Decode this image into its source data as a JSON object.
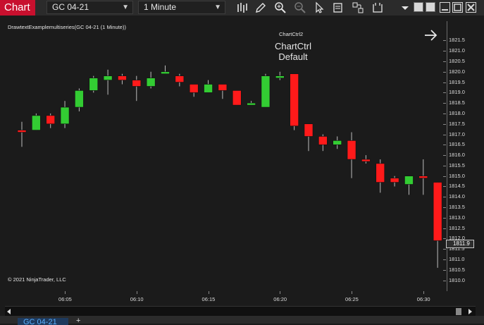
{
  "toolbar": {
    "chart_tab_label": "Chart",
    "instrument": "GC 04-21",
    "interval": "1 Minute"
  },
  "chart": {
    "title": "DrawtextExamplemultiseries(GC 04-21 (1 Minute))",
    "copyright": "© 2021 NinjaTrader, LLC",
    "annotation_small": "ChartCtrl2",
    "annotation_line1": "ChartCtrl",
    "annotation_line2": "Default",
    "last_price_label": "1811.9",
    "price_axis": [
      "1821.5",
      "1821.0",
      "1820.5",
      "1820.0",
      "1819.5",
      "1819.0",
      "1818.5",
      "1818.0",
      "1817.5",
      "1817.0",
      "1816.5",
      "1816.0",
      "1815.5",
      "1815.0",
      "1814.5",
      "1814.0",
      "1813.5",
      "1813.0",
      "1812.5",
      "1812.0",
      "1811.5",
      "1811.0",
      "1810.5",
      "1810.0"
    ],
    "time_axis": [
      "06:05",
      "06:10",
      "06:15",
      "06:20",
      "06:25",
      "06:30"
    ]
  },
  "chart_data": {
    "type": "candlestick",
    "ylim": [
      1809.75,
      1821.75
    ],
    "up_color": "#33cc33",
    "down_color": "#ff1a1a",
    "candles": [
      {
        "o": 1817.2,
        "h": 1817.6,
        "l": 1816.4,
        "c": 1817.1
      },
      {
        "o": 1817.2,
        "h": 1818.0,
        "l": 1817.2,
        "c": 1817.9
      },
      {
        "o": 1817.9,
        "h": 1818.0,
        "l": 1817.3,
        "c": 1817.5
      },
      {
        "o": 1817.5,
        "h": 1818.6,
        "l": 1817.3,
        "c": 1818.3
      },
      {
        "o": 1818.3,
        "h": 1819.2,
        "l": 1818.1,
        "c": 1819.1
      },
      {
        "o": 1819.1,
        "h": 1819.8,
        "l": 1819.0,
        "c": 1819.7
      },
      {
        "o": 1819.6,
        "h": 1820.1,
        "l": 1818.9,
        "c": 1819.8
      },
      {
        "o": 1819.8,
        "h": 1819.9,
        "l": 1819.4,
        "c": 1819.6
      },
      {
        "o": 1819.6,
        "h": 1819.8,
        "l": 1818.6,
        "c": 1819.3
      },
      {
        "o": 1819.3,
        "h": 1820.0,
        "l": 1819.2,
        "c": 1819.7
      },
      {
        "o": 1819.9,
        "h": 1820.3,
        "l": 1819.9,
        "c": 1820.0
      },
      {
        "o": 1819.8,
        "h": 1819.9,
        "l": 1819.3,
        "c": 1819.5
      },
      {
        "o": 1819.4,
        "h": 1819.4,
        "l": 1818.8,
        "c": 1819.0
      },
      {
        "o": 1819.0,
        "h": 1819.6,
        "l": 1819.0,
        "c": 1819.4
      },
      {
        "o": 1819.4,
        "h": 1819.4,
        "l": 1818.7,
        "c": 1819.1
      },
      {
        "o": 1819.1,
        "h": 1819.1,
        "l": 1818.4,
        "c": 1818.4
      },
      {
        "o": 1818.4,
        "h": 1818.6,
        "l": 1818.4,
        "c": 1818.5
      },
      {
        "o": 1818.3,
        "h": 1819.9,
        "l": 1818.3,
        "c": 1819.8
      },
      {
        "o": 1819.7,
        "h": 1820.0,
        "l": 1819.6,
        "c": 1819.8
      },
      {
        "o": 1819.9,
        "h": 1819.9,
        "l": 1817.2,
        "c": 1817.4
      },
      {
        "o": 1817.5,
        "h": 1817.5,
        "l": 1816.2,
        "c": 1816.9
      },
      {
        "o": 1816.9,
        "h": 1817.0,
        "l": 1816.2,
        "c": 1816.5
      },
      {
        "o": 1816.5,
        "h": 1816.9,
        "l": 1816.3,
        "c": 1816.7
      },
      {
        "o": 1816.7,
        "h": 1817.1,
        "l": 1814.9,
        "c": 1815.8
      },
      {
        "o": 1815.8,
        "h": 1816.0,
        "l": 1815.6,
        "c": 1815.7
      },
      {
        "o": 1815.6,
        "h": 1815.8,
        "l": 1814.2,
        "c": 1814.7
      },
      {
        "o": 1814.9,
        "h": 1815.0,
        "l": 1814.5,
        "c": 1814.7
      },
      {
        "o": 1814.6,
        "h": 1815.0,
        "l": 1814.1,
        "c": 1815.0
      },
      {
        "o": 1815.0,
        "h": 1815.8,
        "l": 1814.1,
        "c": 1814.9
      },
      {
        "o": 1814.7,
        "h": 1814.7,
        "l": 1810.6,
        "c": 1811.9
      }
    ]
  }
}
